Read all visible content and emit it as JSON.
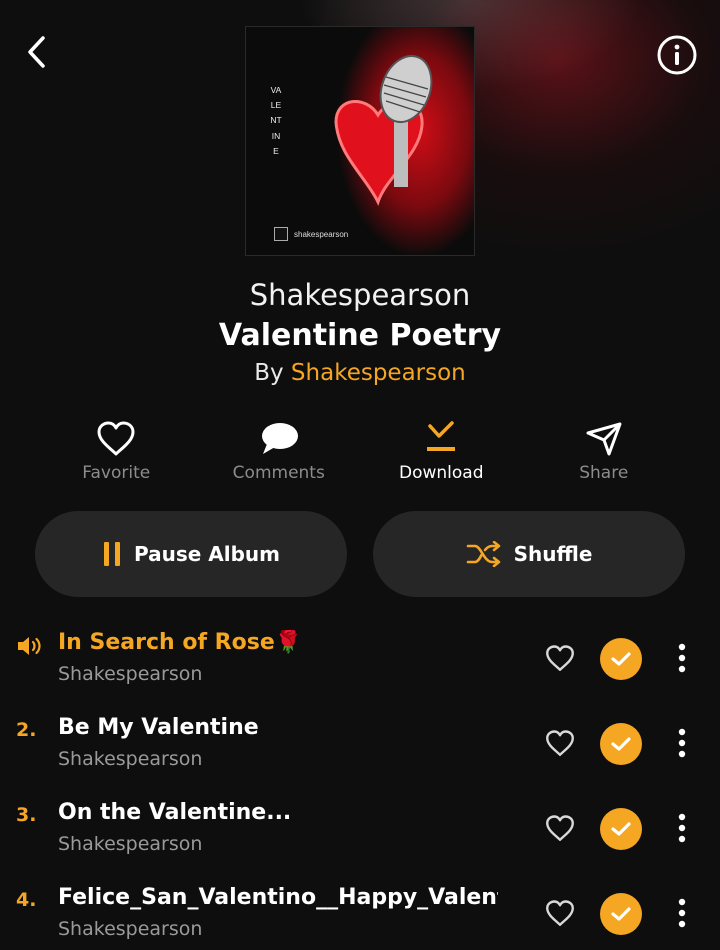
{
  "header": {
    "back_icon": "chevron-left-icon",
    "info_icon": "info-circle-icon"
  },
  "cover": {
    "vertical_text": "VALENTINE",
    "brand_text": "shakespearson"
  },
  "album": {
    "subtitle": "Shakespearson",
    "title": "Valentine Poetry",
    "by_prefix": "By",
    "artist": "Shakespearson"
  },
  "actions": {
    "favorite": "Favorite",
    "comments": "Comments",
    "download": "Download",
    "share": "Share"
  },
  "buttons": {
    "pause": "Pause Album",
    "shuffle": "Shuffle"
  },
  "colors": {
    "accent": "#f5a623",
    "pill_bg": "#262626",
    "background": "#0e0e0e"
  },
  "tracks": [
    {
      "number": "",
      "title": "In Search of Rose",
      "emoji": "🌹",
      "artist": "Shakespearson",
      "playing": true
    },
    {
      "number": "2.",
      "title": "Be My Valentine",
      "emoji": "",
      "artist": "Shakespearson",
      "playing": false
    },
    {
      "number": "3.",
      "title": "On the Valentine...",
      "emoji": "",
      "artist": "Shakespearson",
      "playing": false
    },
    {
      "number": "4.",
      "title": "Felice_San_Valentino__Happy_Valenti...",
      "emoji": "",
      "artist": "Shakespearson",
      "playing": false
    }
  ]
}
